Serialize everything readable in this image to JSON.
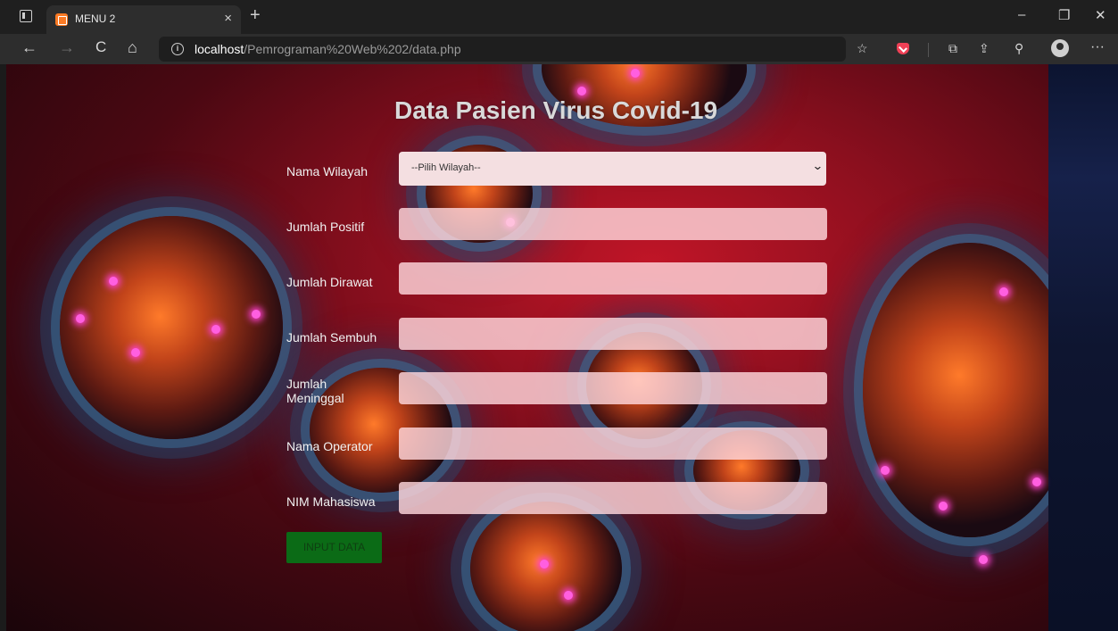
{
  "browser": {
    "tab_title": "MENU 2",
    "tab_close": "×",
    "new_tab": "+",
    "url_host": "localhost",
    "url_path": "/Pemrograman%20Web%202/data.php",
    "window_controls": {
      "minimize": "–",
      "restore": "❐",
      "close": "✕"
    },
    "nav": {
      "back": "←",
      "forward": "→",
      "reload": "C",
      "home": "⌂"
    },
    "toolbar_icons": [
      "favorites-icon",
      "pocket-icon",
      "collections-icon",
      "share-icon",
      "extensions-icon",
      "profile-icon",
      "more-icon"
    ],
    "more": "···"
  },
  "page": {
    "title": "Data Pasien Virus Covid-19",
    "form": {
      "wilayah_label": "Nama Wilayah",
      "wilayah_selected": "--Pilih Wilayah--",
      "positif_label": "Jumlah Positif",
      "dirawat_label": "Jumlah Dirawat",
      "sembuh_label": "Jumlah Sembuh",
      "meninggal_label_line1": "Jumlah",
      "meninggal_label_line2": "Meninggal",
      "operator_label": "Nama Operator",
      "nim_label": "NIM Mahasiswa",
      "submit_label": "INPUT DATA"
    }
  },
  "colors": {
    "background_red": "#c01527",
    "button_green": "#0b6b16",
    "input_pink": "#f4dfe1",
    "virus_dot": "#ff5fe0"
  }
}
